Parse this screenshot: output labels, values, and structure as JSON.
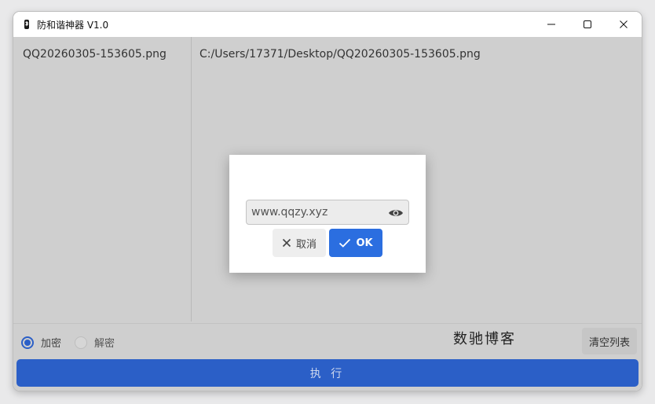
{
  "window": {
    "title": "防和谐神器 V1.0"
  },
  "file_list": {
    "left_items": [
      "QQ20260305-153605.png"
    ],
    "right_items": [
      "C:/Users/17371/Desktop/QQ20260305-153605.png"
    ]
  },
  "mode": {
    "encrypt_label": "加密",
    "decrypt_label": "解密",
    "selected": "加密"
  },
  "watermark": "数驰博客",
  "actions": {
    "clear_label": "清空列表",
    "execute_label": "执 行"
  },
  "dialog": {
    "password_value": "www.qqzy.xyz",
    "cancel_label": "取消",
    "ok_label": "OK"
  },
  "icons": {
    "app": "bluetooth-like-icon",
    "minimize": "minimize-icon",
    "maximize": "maximize-icon",
    "close": "close-icon",
    "eye": "eye-icon",
    "cancel": "x-icon",
    "ok": "check-icon"
  },
  "colors": {
    "accent": "#2b5fc7",
    "ok_button": "#2b6ee0",
    "client_background": "#cfcfcf"
  }
}
